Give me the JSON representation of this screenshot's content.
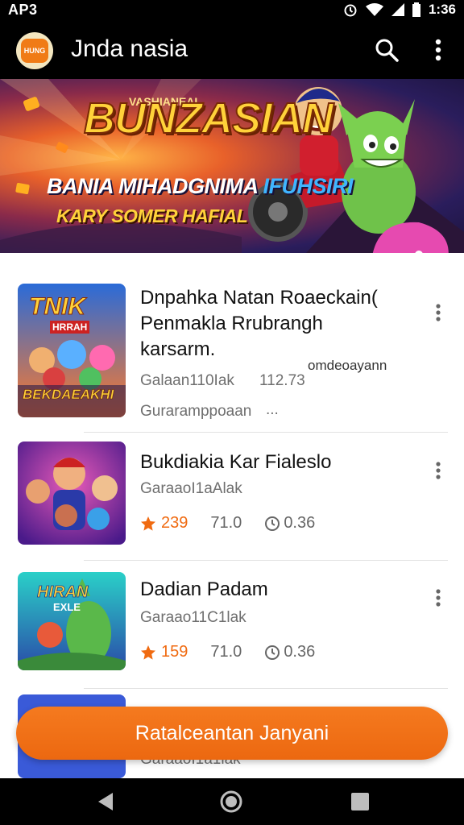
{
  "status_bar": {
    "carrier": "AP3",
    "time": "1:36"
  },
  "app_bar": {
    "logo_text": "HUNG",
    "title": "Jnda nasia"
  },
  "banner": {
    "kicker": "VASHIANEAI",
    "title": "BUNZASIAN",
    "line1_a": "BANIA MIHADGNIMA",
    "line1_b": "IFUHSIRI",
    "line2": "KARY SOMER HAFIAL"
  },
  "games": [
    {
      "thumb_text": "TNIK",
      "thumb_sub": "HRRAH",
      "thumb_bottom": "BEKDAEAKHI",
      "title": "Dnpahka Natan Roaeckain( Penmakla Rrubrangh karsarm.",
      "extra": "omdeoayann",
      "sub": "Galaan110Iak",
      "sub2": "112.73",
      "sub3": "Guraramppoaan",
      "sub4": "..."
    },
    {
      "title": "Bukdiakia Kar Fialeslo",
      "sub": "GaraaoI1aAlak",
      "rating": "239",
      "stat1": "71.0",
      "stat2": "0.36"
    },
    {
      "thumb_text": "HIRAN",
      "thumb_sub": "EXLE",
      "title": "Dadian Padam",
      "sub": "Garaao11C1lak",
      "rating": "159",
      "stat1": "71.0",
      "stat2": "0.36"
    },
    {
      "sub": "GaraaoI1a1lak"
    }
  ],
  "cta": {
    "label": "Ratalceantan Janyani"
  },
  "colors": {
    "accent": "#f06a10",
    "bar": "#000000"
  }
}
